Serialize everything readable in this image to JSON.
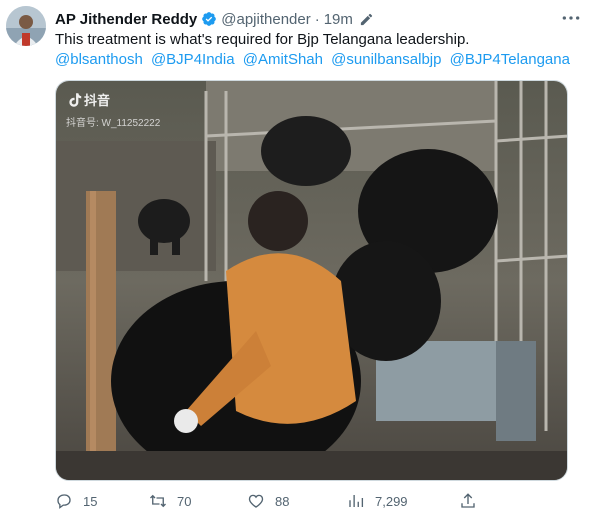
{
  "author": {
    "display_name": "AP Jithender Reddy",
    "handle": "@apjithender",
    "time": "19m"
  },
  "tweet": {
    "text": "This treatment is what's required for Bjp Telangana leadership.",
    "mentions": [
      "@blsanthosh",
      "@BJP4India",
      "@AmitShah",
      "@sunilbansalbjp",
      "@BJP4Telangana"
    ]
  },
  "media": {
    "watermark_text": "抖音",
    "watermark_id": "抖音号: W_11252222"
  },
  "actions": {
    "replies": "15",
    "retweets": "70",
    "likes": "88",
    "views": "7,299"
  },
  "colors": {
    "link": "#1d9bf0",
    "verified": "#1d9bf0",
    "muted": "#536471",
    "text": "#0f1419"
  },
  "icons": [
    "verified-badge-icon",
    "edit-icon",
    "more-icon",
    "tiktok-logo-icon",
    "reply-icon",
    "retweet-icon",
    "like-icon",
    "views-icon",
    "share-icon"
  ]
}
